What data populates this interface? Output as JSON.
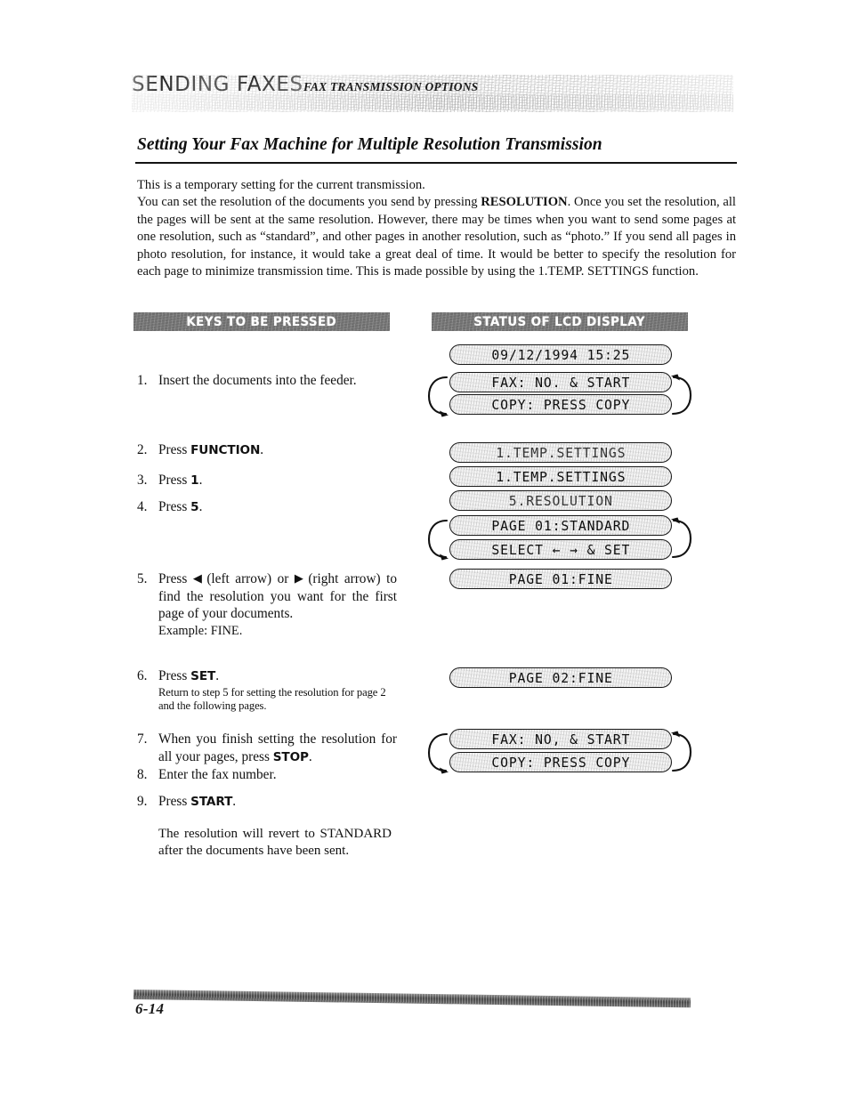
{
  "header": {
    "title": "SENDING FAXES",
    "subtitle": "FAX TRANSMISSION OPTIONS"
  },
  "section": {
    "heading": "Setting Your Fax Machine for Multiple Resolution Transmission"
  },
  "intro": {
    "line1": "This is a temporary setting for the current transmission.",
    "body_before_bold": "You can set the resolution of the documents you send by pressing ",
    "bold_key": "RESOLUTION",
    "body_after_bold": ". Once you set the resolution, all the pages will be sent at the same resolution. However, there may be times when you want to send some pages at one resolution, such as “standard”, and other pages in another resolution, such as “photo.” If you send all pages in photo resolution, for instance, it would take a great deal of time. It would be better to specify the resolution for each page to minimize transmission time. This is made possible by using the 1.TEMP. SETTINGS function."
  },
  "columns": {
    "keys_header": "KEYS TO BE PRESSED",
    "lcd_header": "STATUS OF LCD DISPLAY"
  },
  "steps": [
    {
      "num": "1.",
      "text": "Insert the documents into the feeder."
    },
    {
      "num": "2.",
      "prefix": "Press ",
      "key": "FUNCTION",
      "suffix": "."
    },
    {
      "num": "3.",
      "prefix": "Press ",
      "key": "1",
      "suffix": "."
    },
    {
      "num": "4.",
      "prefix": "Press ",
      "key": "5",
      "suffix": "."
    },
    {
      "num": "5.",
      "seg1": "Press ",
      "left_arrow": "◀",
      "seg2": " (left arrow) or ",
      "right_arrow": "▶",
      "seg3": " (right arrow) to find the resolution you want for the first page of your documents.",
      "example": "Example: FINE."
    },
    {
      "num": "6.",
      "prefix": "Press ",
      "key": "SET",
      "suffix": ".",
      "note": "Return to step 5 for setting the resolution for page 2 and the following pages."
    },
    {
      "num": "7.",
      "prefix": "When you finish setting the resolution for all your pages, press ",
      "key": "STOP",
      "suffix": "."
    },
    {
      "num": "8.",
      "text": "Enter the fax number."
    },
    {
      "num": "9.",
      "prefix": "Press ",
      "key": "START",
      "suffix": "."
    }
  ],
  "closing_note": "The resolution will revert to STANDARD after the documents have been sent.",
  "lcd": {
    "datetime": "09/12/1994 15:25",
    "fax_prompt_1": "FAX: NO. & START",
    "copy_prompt_1": "COPY: PRESS COPY",
    "temp_settings_1": "1.TEMP.SETTINGS",
    "temp_settings_2": "1.TEMP.SETTINGS",
    "resolution_menu": "5.RESOLUTION",
    "page01_standard": "PAGE 01:STANDARD",
    "select_set": "SELECT ← → & SET",
    "page01_fine": "PAGE 01:FINE",
    "page02_fine": "PAGE 02:FINE",
    "fax_prompt_2": "FAX: NO, & START",
    "copy_prompt_2": "COPY: PRESS COPY"
  },
  "footer": {
    "page_number": "6-14"
  }
}
